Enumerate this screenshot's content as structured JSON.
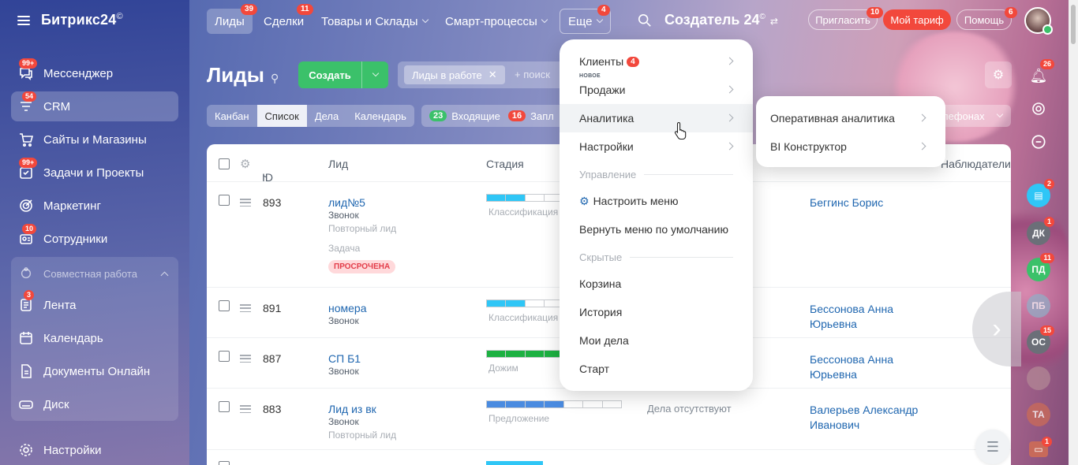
{
  "logo": {
    "text": "Битрикс24",
    "sup": "©"
  },
  "sidebar": {
    "items": [
      {
        "label": "Мессенджер",
        "badge": "99+",
        "icon": "messenger-icon"
      },
      {
        "label": "CRM",
        "badge": "54",
        "icon": "crm-filter-icon"
      },
      {
        "label": "Сайты и Магазины",
        "badge": "",
        "icon": "cart-icon"
      },
      {
        "label": "Задачи и Проекты",
        "badge": "99+",
        "icon": "tasks-icon"
      },
      {
        "label": "Маркетинг",
        "badge": "",
        "icon": "target-icon"
      },
      {
        "label": "Сотрудники",
        "badge": "10",
        "icon": "employees-icon"
      },
      {
        "label": "Лента",
        "badge": "3",
        "icon": "feed-icon"
      },
      {
        "label": "Календарь",
        "badge": "",
        "icon": "calendar-icon"
      },
      {
        "label": "Документы Онлайн",
        "badge": "",
        "icon": "document-icon"
      },
      {
        "label": "Диск",
        "badge": "",
        "icon": "disk-icon"
      },
      {
        "label": "Настройки",
        "badge": "",
        "icon": "settings-icon"
      }
    ],
    "group": "Совместная работа"
  },
  "topnav": {
    "items": [
      {
        "label": "Лиды",
        "badge": "39"
      },
      {
        "label": "Сделки",
        "badge": "11"
      },
      {
        "label": "Товары и Склады",
        "badge": ""
      },
      {
        "label": "Смарт-процессы",
        "badge": ""
      },
      {
        "label": "Еще",
        "badge": "4"
      }
    ],
    "brand": "Создатель 24",
    "brand_sup": "©",
    "invite": "Пригласить",
    "invite_badge": "10",
    "tariff": "Мой тариф",
    "help": "Помощь",
    "help_badge": "6"
  },
  "page": {
    "title": "Лиды",
    "create": "Создать",
    "filter_tag": "Лиды в работе",
    "filter_placeholder": "+ поиск",
    "view_tabs": [
      "Канбан",
      "Список",
      "Дела",
      "Календарь"
    ],
    "counters": [
      {
        "num": "23",
        "label": "Входящие",
        "color": "#3bc16a"
      },
      {
        "num": "16",
        "label": "Запл",
        "color": "#f2483c"
      }
    ],
    "phones_label": "лефонах"
  },
  "table": {
    "headers": {
      "id": "ID",
      "lead": "Лид",
      "stage": "Стадия",
      "observers": "Наблюдатели"
    },
    "rows": [
      {
        "id": "893",
        "name": "лид№5",
        "source": "Звонок",
        "type": "Повторный лид",
        "task": "Задача",
        "overdue": "ПРОСРОЧЕНА",
        "stage": "Классификация",
        "stage_fill": 0.29,
        "stage_color": "#2fc6f6",
        "activity": "",
        "responsible": "Беггинс Борис"
      },
      {
        "id": "891",
        "name": "номера",
        "source": "Звонок",
        "type": "",
        "task": "",
        "overdue": "",
        "stage": "Классификация",
        "stage_fill": 0.29,
        "stage_color": "#2fc6f6",
        "activity": "",
        "responsible": "Бессонова Анна Юрьевна"
      },
      {
        "id": "887",
        "name": "СП Б1",
        "source": "Звонок",
        "type": "",
        "task": "",
        "overdue": "",
        "stage": "Дожим",
        "stage_fill": 0.57,
        "stage_color": "#1db142",
        "activity": "",
        "responsible": "Бессонова Анна Юрьевна"
      },
      {
        "id": "883",
        "name": "Лид из вк",
        "source": "Звонок",
        "type": "Повторный лид",
        "task": "",
        "overdue": "",
        "stage": "Предложение",
        "stage_fill": 0.57,
        "stage_color": "#4a8be0",
        "activity": "Дела отсутствуют",
        "responsible": "Валерьев Александр Иванович"
      }
    ]
  },
  "menu": {
    "items": [
      {
        "label": "Клиенты",
        "badge": "4",
        "new": "",
        "arrow": true
      },
      {
        "label": "Продажи",
        "badge": "",
        "new": "НОВОЕ",
        "arrow": true
      },
      {
        "label": "Аналитика",
        "badge": "",
        "new": "",
        "arrow": true
      },
      {
        "label": "Настройки",
        "badge": "",
        "new": "",
        "arrow": true
      }
    ],
    "section_manage": "Управление",
    "configure": "Настроить меню",
    "reset": "Вернуть меню по умолчанию",
    "section_hidden": "Скрытые",
    "hidden": [
      "Корзина",
      "История",
      "Мои дела",
      "Старт"
    ]
  },
  "submenu": {
    "items": [
      "Оперативная аналитика",
      "BI Конструктор"
    ]
  },
  "rail": {
    "items": [
      {
        "initials": "",
        "badge": "26",
        "icon": "bell-icon"
      },
      {
        "initials": "",
        "badge": "",
        "icon": "target-rail-icon"
      },
      {
        "initials": "",
        "badge": "",
        "icon": "copilot-icon"
      },
      {
        "initials": "",
        "badge": "2",
        "icon": "chat-icon"
      },
      {
        "initials": "ДК",
        "badge": "1",
        "color": "#6b6f78"
      },
      {
        "initials": "ПД",
        "badge": "11",
        "color": "#3bc16a"
      },
      {
        "initials": "ПБ",
        "badge": "",
        "color": "#8fb0c8"
      },
      {
        "initials": "ОС",
        "badge": "15",
        "color": "#6b6f78"
      },
      {
        "initials": "",
        "badge": "",
        "color": "#b48a96"
      },
      {
        "initials": "ТА",
        "badge": "",
        "color": "#c86a5a"
      },
      {
        "initials": "",
        "badge": "1",
        "icon": "contact-card-icon"
      }
    ]
  }
}
